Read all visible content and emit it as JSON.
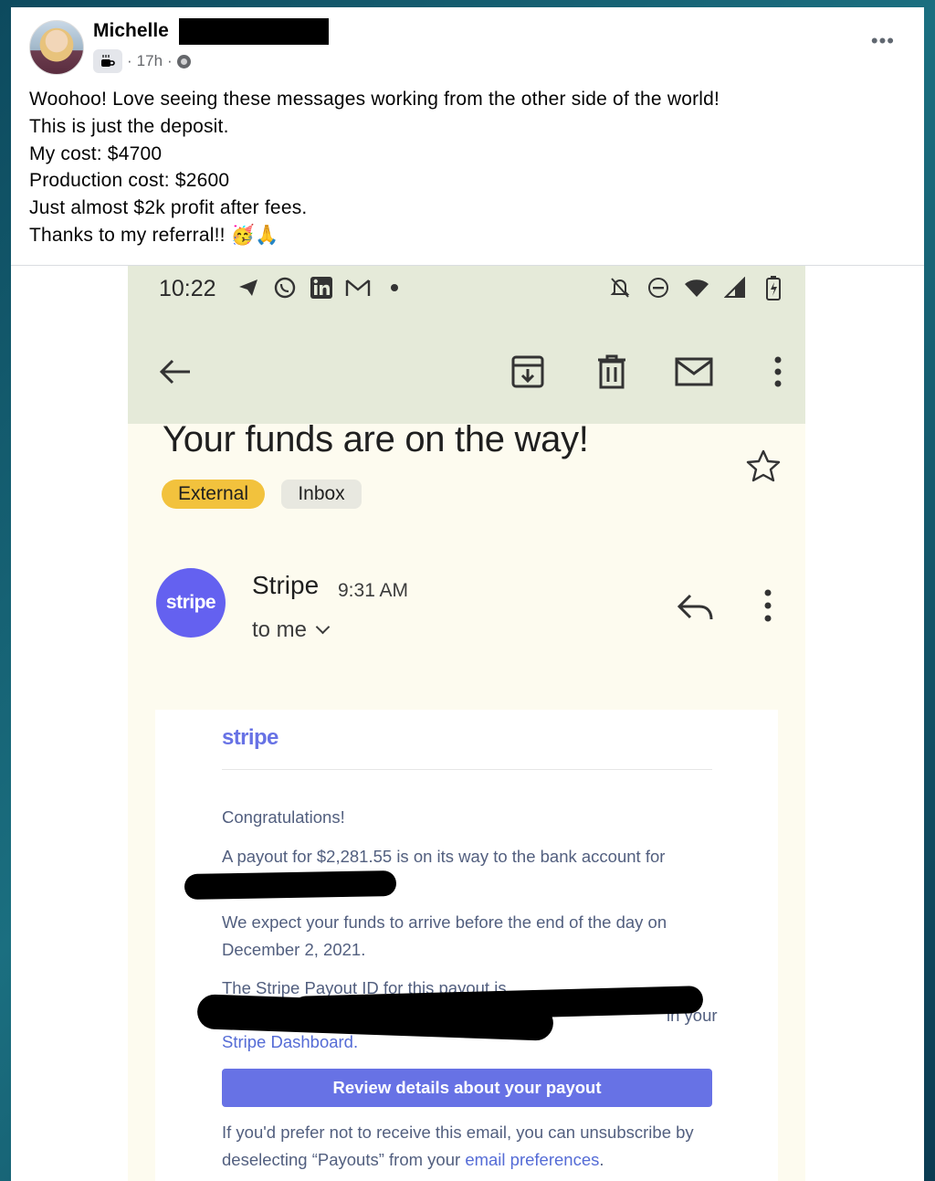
{
  "post": {
    "author": "Michelle",
    "age": "17h",
    "separator": "·",
    "more": "•••",
    "badge_icon": "coffee-cup-icon",
    "privacy_icon": "friends-icon",
    "lines": [
      "Woohoo! Love seeing these messages working from the other side of the world!",
      "This is just the deposit.",
      "My cost: $4700",
      "Production cost: $2600",
      "Just almost $2k profit after fees.",
      "Thanks to my referral!! 🥳🙏"
    ]
  },
  "phone": {
    "status_time": "10:22",
    "status_icons_left": [
      "telegram-icon",
      "whatsapp-icon",
      "linkedin-icon",
      "gmail-icon",
      "dot-icon"
    ],
    "status_icons_right": [
      "alarm-off-icon",
      "dnd-icon",
      "wifi-icon",
      "signal-icon",
      "battery-icon"
    ],
    "subject": "Your funds are on the way!",
    "chips": {
      "external": "External",
      "inbox": "Inbox"
    },
    "sender": {
      "avatar_text": "stripe",
      "name": "Stripe",
      "time": "9:31 AM",
      "to": "to me"
    },
    "email": {
      "logo": "stripe",
      "greeting": "Congratulations!",
      "payout_line": "A payout for $2,281.55 is on its way to the bank account for",
      "expect_line": "We expect your funds to arrive before the end of the day on December 2, 2021.",
      "payout_id_line": "The Stripe Payout ID for this payout is",
      "payout_id_tail": "in your",
      "dashboard_text": "Stripe Dashboard.",
      "button": "Review details about your payout",
      "unsubscribe_pre": "If you'd prefer not to receive this email, you can unsubscribe by deselecting “Payouts” from your ",
      "unsubscribe_link": "email preferences",
      "unsubscribe_post": "."
    }
  },
  "colors": {
    "stripe_purple": "#6772e5",
    "avatar_purple": "#6461f0",
    "external_chip": "#f2c23d",
    "phone_header": "#e5ead9"
  }
}
